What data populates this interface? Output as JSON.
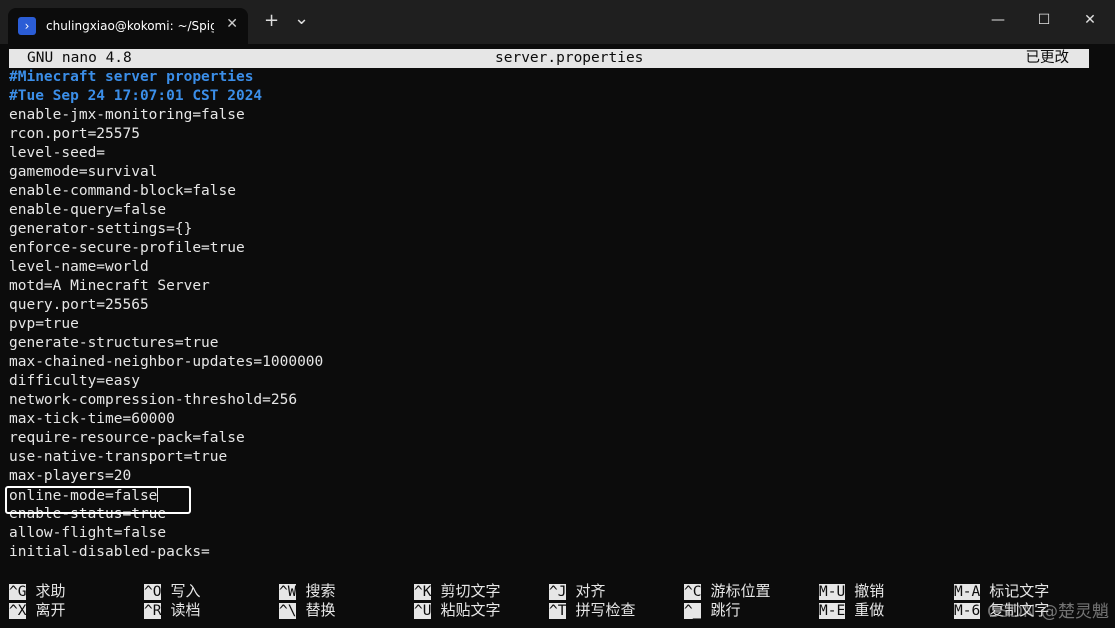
{
  "window": {
    "tab_title": "chulingxiao@kokomi: ~/Spigot",
    "tab_close": "✕",
    "new_tab": "+",
    "dropdown": "⌄",
    "minimize": "—",
    "maximize": "☐",
    "close": "✕"
  },
  "nano": {
    "version": "GNU nano 4.8",
    "filename": "server.properties",
    "status": "已更改"
  },
  "lines": [
    {
      "text": "#Minecraft server properties",
      "comment": true
    },
    {
      "text": "#Tue Sep 24 17:07:01 CST 2024",
      "comment": true
    },
    {
      "text": "enable-jmx-monitoring=false"
    },
    {
      "text": "rcon.port=25575"
    },
    {
      "text": "level-seed="
    },
    {
      "text": "gamemode=survival"
    },
    {
      "text": "enable-command-block=false"
    },
    {
      "text": "enable-query=false"
    },
    {
      "text": "generator-settings={}"
    },
    {
      "text": "enforce-secure-profile=true"
    },
    {
      "text": "level-name=world"
    },
    {
      "text": "motd=A Minecraft Server"
    },
    {
      "text": "query.port=25565"
    },
    {
      "text": "pvp=true"
    },
    {
      "text": "generate-structures=true"
    },
    {
      "text": "max-chained-neighbor-updates=1000000"
    },
    {
      "text": "difficulty=easy"
    },
    {
      "text": "network-compression-threshold=256"
    },
    {
      "text": "max-tick-time=60000"
    },
    {
      "text": "require-resource-pack=false"
    },
    {
      "text": "use-native-transport=true"
    },
    {
      "text": "max-players=20"
    },
    {
      "text": "online-mode=false",
      "cursor": true
    },
    {
      "text": "enable-status=true"
    },
    {
      "text": "allow-flight=false"
    },
    {
      "text": "initial-disabled-packs="
    }
  ],
  "shortcuts": [
    {
      "key": "^G",
      "label": "求助"
    },
    {
      "key": "^X",
      "label": "离开"
    },
    {
      "key": "^O",
      "label": "写入"
    },
    {
      "key": "^R",
      "label": "读档"
    },
    {
      "key": "^W",
      "label": "搜索"
    },
    {
      "key": "^\\",
      "label": "替换"
    },
    {
      "key": "^K",
      "label": "剪切文字"
    },
    {
      "key": "^U",
      "label": "粘贴文字"
    },
    {
      "key": "^J",
      "label": "对齐"
    },
    {
      "key": "^T",
      "label": "拼写检查"
    },
    {
      "key": "^C",
      "label": "游标位置"
    },
    {
      "key": "^_",
      "label": "跳行"
    },
    {
      "key": "M-U",
      "label": "撤销"
    },
    {
      "key": "M-E",
      "label": "重做"
    },
    {
      "key": "M-A",
      "label": "标记文字"
    },
    {
      "key": "M-6",
      "label": "复制文字"
    }
  ],
  "watermark": "CSDN @楚灵魈"
}
